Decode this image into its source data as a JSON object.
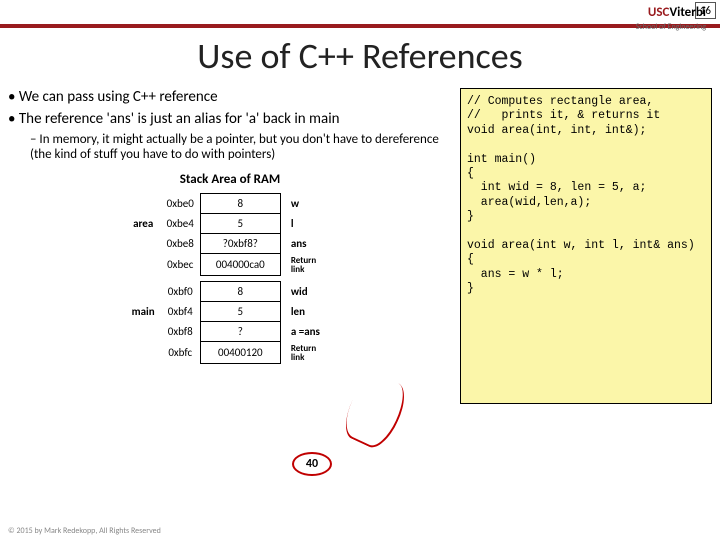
{
  "page_number": "16",
  "logo": {
    "usc": "USC",
    "viterbi": "Viterbi",
    "sub": "School of Engineering"
  },
  "title": "Use of C++ References",
  "bullets": {
    "b1": "We can pass using C++ reference",
    "b2": "The reference 'ans' is just an alias for 'a' back in main",
    "sub": "In memory, it might actually be a pointer, but you don't have to dereference (the kind of stuff you have to do with pointers)"
  },
  "stack_title": "Stack Area of RAM",
  "stack": {
    "area_label": "area",
    "main_label": "main",
    "rows": [
      {
        "addr": "0xbe0",
        "val": "8",
        "name": "w"
      },
      {
        "addr": "0xbe4",
        "val": "5",
        "name": "l"
      },
      {
        "addr": "0xbe8",
        "val": "?0xbf8?",
        "name": "ans"
      },
      {
        "addr": "0xbec",
        "val": "004000ca0",
        "name_top": "Return",
        "name_bot": "link"
      },
      {
        "addr": "0xbf0",
        "val": "8",
        "name": "wid"
      },
      {
        "addr": "0xbf4",
        "val": "5",
        "name": "len"
      },
      {
        "addr": "0xbf8",
        "val": "?",
        "name": "a  =ans"
      },
      {
        "addr": "0xbfc",
        "val": "00400120",
        "name_top": "Return",
        "name_bot": "link"
      }
    ]
  },
  "overlay_val": "40",
  "code": "// Computes rectangle area,\n//   prints it, & returns it\nvoid area(int, int, int&);\n\nint main()\n{\n  int wid = 8, len = 5, a;\n  area(wid,len,a);\n}\n\nvoid area(int w, int l, int& ans)\n{\n  ans = w * l;\n}",
  "credit": "© 2015 by Mark Redekopp, All Rights Reserved"
}
